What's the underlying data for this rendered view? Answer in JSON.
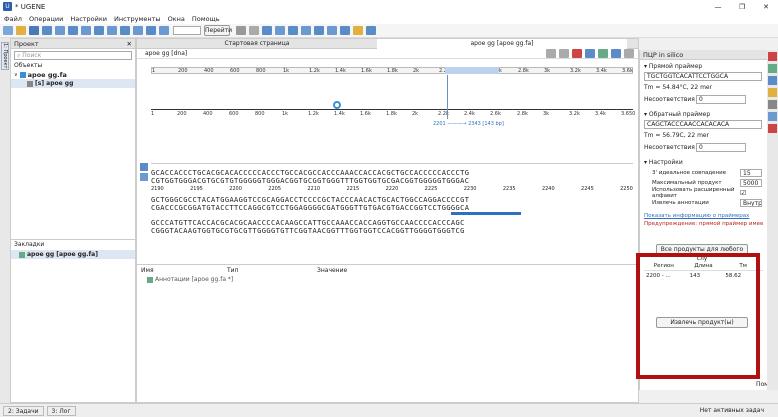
{
  "window": {
    "title": "* UGENE",
    "controls": [
      "—",
      "❐",
      "✕"
    ]
  },
  "menu": [
    "Файл",
    "Операции",
    "Настройки",
    "Инструменты",
    "Окна",
    "Помощь"
  ],
  "toolbar": {
    "zoom_value": "",
    "go_label": "Перейти"
  },
  "left_tabs": {
    "project": "1: Проект"
  },
  "project": {
    "panel_title": "Проект",
    "search_placeholder": "Поиск",
    "objects_label": "Объекты",
    "tree": [
      {
        "label": "apoe gg.fa"
      },
      {
        "label": "[s] apoe gg"
      }
    ],
    "bookmarks_label": "Закладки",
    "bookmark_item": "apoe gg [apoe gg.fa]"
  },
  "center": {
    "tabs": [
      "Стартовая страница",
      "apoe gg [apoe gg.fa]"
    ],
    "seq_name": "apoe gg [dna]",
    "ruler_ticks_top": [
      "1",
      "200",
      "400",
      "600",
      "800",
      "1k",
      "1.2k",
      "1.4k",
      "1.6k",
      "1.8k",
      "2k",
      "2.2k",
      "2.4k",
      "2.6k",
      "2.8k",
      "3k",
      "3.2k",
      "3.4k",
      "3.6k"
    ],
    "ruler_ticks_bottom": [
      "1",
      "200",
      "400",
      "600",
      "800",
      "1k",
      "1.2k",
      "1.4k",
      "1.6k",
      "1.8k",
      "2k",
      "2.2k",
      "2.4k",
      "2.6k",
      "2.8k",
      "3k",
      "3.2k",
      "3.4k",
      "3.650"
    ],
    "product_annotation": "2201 ———→ 2343  [143 bp]",
    "seq_lines": [
      "GCACCACCCTGCACGCACACCCCCACCCTGCCACGCCACCCAAACCACCACGCTGCCACCCCCACCCTG",
      "CGTGGTGGGACGTGCGTGTGGGGGTGGGACGGTGCGGTGGGTTTGGTGGTGCGACGGTGGGGGTGGGAC",
      "GCTGGGCGCCTACATGGAAGGTCCGCAGGACCTCCCCGCTACCCAACACTGCACTGGCCAGGACCCCGT",
      "CGACCCGCGGATGTACCTTCCAGGCGTCCTGGAGGGGCGATGGGTTGTGACGTGACCGGTCCTGGGGCA",
      "GCCCATGTTCACCACGCACGCAACCCCACAAGCCATTGCCAAACCACCAGGTGCCAACCCCACCCAGC",
      "CGGGTACAAGTGGTGCGTGCGTTGGGGTGTTCGGTAACGGTTTGGTGGTCCACGGTTGGGGTGGGTCG"
    ],
    "seq_positions": [
      "2190",
      "2195",
      "2200",
      "2205",
      "2210",
      "2215",
      "2220",
      "2225",
      "2230",
      "2235",
      "2240",
      "2245",
      "2250"
    ],
    "annotation_cols": [
      "Имя",
      "Тип",
      "Значение"
    ],
    "annotation_row": "Аннотации [apoe gg.fa *]"
  },
  "pcr": {
    "title": "ПЦР in silico",
    "forward_label": "Прямой праймер",
    "forward_seq": "TGCTGGTCACATTCCTGGCA",
    "forward_tm": "Tm = 54.84°C, 22 mer",
    "mismatches_label": "Несоответствия",
    "mismatches_value": "0",
    "reverse_label": "Обратный праймер",
    "reverse_seq": "CAGCTACCCAACCACACACA",
    "reverse_tm": "Tm = 56.79C, 22 mer",
    "settings_label": "Настройки",
    "settings": [
      {
        "label": "3' идеальное совпадение",
        "value": "15"
      },
      {
        "label": "Максимальный продукт",
        "value": "5000"
      },
      {
        "label": "Использовать расширенный алфавит",
        "value": "☑"
      },
      {
        "label": "Извлечь аннотации",
        "value": "Внутр"
      }
    ],
    "primer_info_link": "Показать информацию о праймерах",
    "warning": "Предупреждение: прямой праймер имее",
    "products_button": "Все продукты для любого слу",
    "table_cols": [
      "Регион",
      "Длина",
      "Тм"
    ],
    "table_row": [
      "2200 - ...",
      "143",
      "58.62"
    ],
    "extract_button": "Извлечь продукт(ы)",
    "right_side_label": "Пом"
  },
  "status": {
    "tasks_tab": "2: Задачи",
    "log_tab": "3: Лог",
    "right": "Нет активных задач"
  },
  "colors": {
    "highlight": "#b01010",
    "selection": "#dde6f3",
    "primer": "#3070c0"
  }
}
